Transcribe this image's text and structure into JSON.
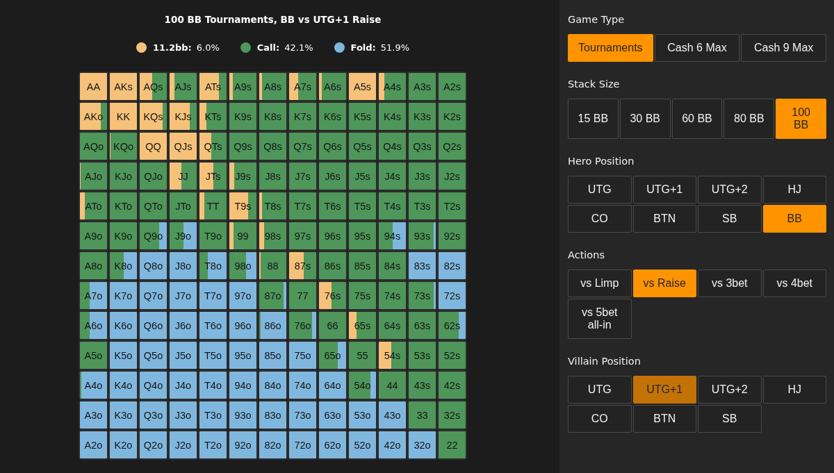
{
  "chart": {
    "title": "100 BB Tournaments, BB vs UTG+1 Raise",
    "legend": [
      {
        "kind": "raise",
        "label": "11.2bb:",
        "value": "6.0%",
        "color": "#f6c27a"
      },
      {
        "kind": "call",
        "label": "Call:",
        "value": "42.1%",
        "color": "#4e965a"
      },
      {
        "kind": "fold",
        "label": "Fold:",
        "value": "51.9%",
        "color": "#80b7df"
      }
    ],
    "rows": [
      {
        "cells": [
          {
            "hand": "AA",
            "segments": [
              {
                "kind": "raise",
                "level": 1
              }
            ]
          },
          {
            "hand": "AKs",
            "segments": [
              {
                "kind": "raise",
                "level": 1
              }
            ]
          },
          {
            "hand": "AQs",
            "segments": [
              {
                "kind": "raise",
                "level": 0.45
              },
              {
                "kind": "call",
                "level": 0.55
              }
            ]
          },
          {
            "hand": "AJs",
            "segments": [
              {
                "kind": "raise",
                "level": 0.17
              },
              {
                "kind": "call",
                "level": 0.83
              }
            ]
          },
          {
            "hand": "ATs",
            "segments": [
              {
                "kind": "raise",
                "level": 0.72
              },
              {
                "kind": "call",
                "level": 0.28
              }
            ]
          },
          {
            "hand": "A9s",
            "segments": [
              {
                "kind": "raise",
                "level": 0.12
              },
              {
                "kind": "call",
                "level": 0.88
              }
            ]
          },
          {
            "hand": "A8s",
            "segments": [
              {
                "kind": "raise",
                "level": 0.1
              },
              {
                "kind": "call",
                "level": 0.9
              }
            ]
          },
          {
            "hand": "A7s",
            "segments": [
              {
                "kind": "raise",
                "level": 0.34
              },
              {
                "kind": "call",
                "level": 0.66
              }
            ]
          },
          {
            "hand": "A6s",
            "segments": [
              {
                "kind": "raise",
                "level": 0.1
              },
              {
                "kind": "call",
                "level": 0.9
              }
            ]
          },
          {
            "hand": "A5s",
            "segments": [
              {
                "kind": "raise",
                "level": 1
              }
            ]
          },
          {
            "hand": "A4s",
            "segments": [
              {
                "kind": "raise",
                "level": 0.2
              },
              {
                "kind": "call",
                "level": 0.8
              }
            ]
          },
          {
            "hand": "A3s",
            "segments": [
              {
                "kind": "call",
                "level": 1
              }
            ]
          },
          {
            "hand": "A2s",
            "segments": [
              {
                "kind": "call",
                "level": 1
              }
            ]
          }
        ]
      },
      {
        "cells": [
          {
            "hand": "AKo",
            "segments": [
              {
                "kind": "raise",
                "level": 0.76
              },
              {
                "kind": "call",
                "level": 0.24
              }
            ]
          },
          {
            "hand": "KK",
            "segments": [
              {
                "kind": "raise",
                "level": 1
              }
            ]
          },
          {
            "hand": "KQs",
            "segments": [
              {
                "kind": "raise",
                "level": 0.85
              },
              {
                "kind": "call",
                "level": 0.15
              }
            ]
          },
          {
            "hand": "KJs",
            "segments": [
              {
                "kind": "raise",
                "level": 0.74
              },
              {
                "kind": "call",
                "level": 0.26
              }
            ]
          },
          {
            "hand": "KTs",
            "segments": [
              {
                "kind": "raise",
                "level": 0.25
              },
              {
                "kind": "call",
                "level": 0.75
              }
            ]
          },
          {
            "hand": "K9s",
            "segments": [
              {
                "kind": "call",
                "level": 1
              }
            ]
          },
          {
            "hand": "K8s",
            "segments": [
              {
                "kind": "call",
                "level": 1
              }
            ]
          },
          {
            "hand": "K7s",
            "segments": [
              {
                "kind": "call",
                "level": 1
              }
            ]
          },
          {
            "hand": "K6s",
            "segments": [
              {
                "kind": "call",
                "level": 1
              }
            ]
          },
          {
            "hand": "K5s",
            "segments": [
              {
                "kind": "call",
                "level": 1
              }
            ]
          },
          {
            "hand": "K4s",
            "segments": [
              {
                "kind": "call",
                "level": 1
              }
            ]
          },
          {
            "hand": "K3s",
            "segments": [
              {
                "kind": "call",
                "level": 1
              }
            ]
          },
          {
            "hand": "K2s",
            "segments": [
              {
                "kind": "call",
                "level": 1
              }
            ]
          }
        ]
      },
      {
        "cells": [
          {
            "hand": "AQo",
            "segments": [
              {
                "kind": "call",
                "level": 1
              }
            ]
          },
          {
            "hand": "KQo",
            "segments": [
              {
                "kind": "raise",
                "level": 0.03
              },
              {
                "kind": "call",
                "level": 0.97
              }
            ]
          },
          {
            "hand": "QQ",
            "segments": [
              {
                "kind": "raise",
                "level": 1
              }
            ]
          },
          {
            "hand": "QJs",
            "segments": [
              {
                "kind": "raise",
                "level": 1
              }
            ]
          },
          {
            "hand": "QTs",
            "segments": [
              {
                "kind": "raise",
                "level": 0.43
              },
              {
                "kind": "call",
                "level": 0.57
              }
            ]
          },
          {
            "hand": "Q9s",
            "segments": [
              {
                "kind": "call",
                "level": 1
              }
            ]
          },
          {
            "hand": "Q8s",
            "segments": [
              {
                "kind": "call",
                "level": 1
              }
            ]
          },
          {
            "hand": "Q7s",
            "segments": [
              {
                "kind": "call",
                "level": 1
              }
            ]
          },
          {
            "hand": "Q6s",
            "segments": [
              {
                "kind": "call",
                "level": 1
              }
            ]
          },
          {
            "hand": "Q5s",
            "segments": [
              {
                "kind": "call",
                "level": 1
              }
            ]
          },
          {
            "hand": "Q4s",
            "segments": [
              {
                "kind": "call",
                "level": 1
              }
            ]
          },
          {
            "hand": "Q3s",
            "segments": [
              {
                "kind": "call",
                "level": 1
              }
            ]
          },
          {
            "hand": "Q2s",
            "segments": [
              {
                "kind": "call",
                "level": 1
              }
            ]
          }
        ]
      },
      {
        "cells": [
          {
            "hand": "AJo",
            "segments": [
              {
                "kind": "raise",
                "level": 0.03
              },
              {
                "kind": "call",
                "level": 0.97
              }
            ]
          },
          {
            "hand": "KJo",
            "segments": [
              {
                "kind": "call",
                "level": 1
              }
            ]
          },
          {
            "hand": "QJo",
            "segments": [
              {
                "kind": "call",
                "level": 1
              }
            ]
          },
          {
            "hand": "JJ",
            "segments": [
              {
                "kind": "raise",
                "level": 0.43
              },
              {
                "kind": "call",
                "level": 0.57
              }
            ]
          },
          {
            "hand": "JTs",
            "segments": [
              {
                "kind": "raise",
                "level": 0.52
              },
              {
                "kind": "call",
                "level": 0.48
              }
            ]
          },
          {
            "hand": "J9s",
            "segments": [
              {
                "kind": "raise",
                "level": 0.18
              },
              {
                "kind": "call",
                "level": 0.82
              }
            ]
          },
          {
            "hand": "J8s",
            "segments": [
              {
                "kind": "call",
                "level": 1
              }
            ]
          },
          {
            "hand": "J7s",
            "segments": [
              {
                "kind": "call",
                "level": 1
              }
            ]
          },
          {
            "hand": "J6s",
            "segments": [
              {
                "kind": "call",
                "level": 1
              }
            ]
          },
          {
            "hand": "J5s",
            "segments": [
              {
                "kind": "call",
                "level": 1
              }
            ]
          },
          {
            "hand": "J4s",
            "segments": [
              {
                "kind": "call",
                "level": 1
              }
            ]
          },
          {
            "hand": "J3s",
            "segments": [
              {
                "kind": "call",
                "level": 1
              }
            ]
          },
          {
            "hand": "J2s",
            "segments": [
              {
                "kind": "call",
                "level": 1
              }
            ]
          }
        ]
      },
      {
        "cells": [
          {
            "hand": "ATo",
            "segments": [
              {
                "kind": "raise",
                "level": 0.17
              },
              {
                "kind": "call",
                "level": 0.83
              }
            ]
          },
          {
            "hand": "KTo",
            "segments": [
              {
                "kind": "call",
                "level": 1
              }
            ]
          },
          {
            "hand": "QTo",
            "segments": [
              {
                "kind": "call",
                "level": 1
              }
            ]
          },
          {
            "hand": "JTo",
            "segments": [
              {
                "kind": "call",
                "level": 1
              }
            ]
          },
          {
            "hand": "TT",
            "segments": [
              {
                "kind": "raise",
                "level": 0.19
              },
              {
                "kind": "call",
                "level": 0.81
              }
            ]
          },
          {
            "hand": "T9s",
            "segments": [
              {
                "kind": "raise",
                "level": 0.68
              },
              {
                "kind": "call",
                "level": 0.32
              }
            ]
          },
          {
            "hand": "T8s",
            "segments": [
              {
                "kind": "raise",
                "level": 0.1
              },
              {
                "kind": "call",
                "level": 0.9
              }
            ]
          },
          {
            "hand": "T7s",
            "segments": [
              {
                "kind": "call",
                "level": 1
              }
            ]
          },
          {
            "hand": "T6s",
            "segments": [
              {
                "kind": "call",
                "level": 1
              }
            ]
          },
          {
            "hand": "T5s",
            "segments": [
              {
                "kind": "call",
                "level": 1
              }
            ]
          },
          {
            "hand": "T4s",
            "segments": [
              {
                "kind": "call",
                "level": 1
              }
            ]
          },
          {
            "hand": "T3s",
            "segments": [
              {
                "kind": "call",
                "level": 1
              }
            ]
          },
          {
            "hand": "T2s",
            "segments": [
              {
                "kind": "call",
                "level": 1
              }
            ]
          }
        ]
      },
      {
        "cells": [
          {
            "hand": "A9o",
            "segments": [
              {
                "kind": "call",
                "level": 1
              }
            ]
          },
          {
            "hand": "K9o",
            "segments": [
              {
                "kind": "call",
                "level": 1
              }
            ]
          },
          {
            "hand": "Q9o",
            "segments": [
              {
                "kind": "call",
                "level": 0.72
              },
              {
                "kind": "fold",
                "level": 0.28
              }
            ]
          },
          {
            "hand": "J9o",
            "segments": [
              {
                "kind": "call",
                "level": 0.52
              },
              {
                "kind": "fold",
                "level": 0.48
              }
            ]
          },
          {
            "hand": "T9o",
            "segments": [
              {
                "kind": "call",
                "level": 1
              }
            ]
          },
          {
            "hand": "99",
            "segments": [
              {
                "kind": "raise",
                "level": 0.15
              },
              {
                "kind": "call",
                "level": 0.85
              }
            ]
          },
          {
            "hand": "98s",
            "segments": [
              {
                "kind": "raise",
                "level": 0.17
              },
              {
                "kind": "call",
                "level": 0.83
              }
            ]
          },
          {
            "hand": "97s",
            "segments": [
              {
                "kind": "call",
                "level": 1
              }
            ]
          },
          {
            "hand": "96s",
            "segments": [
              {
                "kind": "call",
                "level": 1
              }
            ]
          },
          {
            "hand": "95s",
            "segments": [
              {
                "kind": "call",
                "level": 1
              }
            ]
          },
          {
            "hand": "94s",
            "segments": [
              {
                "kind": "call",
                "level": 0.5
              },
              {
                "kind": "fold",
                "level": 0.5
              }
            ]
          },
          {
            "hand": "93s",
            "segments": [
              {
                "kind": "call",
                "level": 0.92
              },
              {
                "kind": "fold",
                "level": 0.08
              }
            ]
          },
          {
            "hand": "92s",
            "segments": [
              {
                "kind": "call",
                "level": 1
              }
            ]
          }
        ]
      },
      {
        "cells": [
          {
            "hand": "A8o",
            "segments": [
              {
                "kind": "call",
                "level": 1
              }
            ]
          },
          {
            "hand": "K8o",
            "segments": [
              {
                "kind": "call",
                "level": 0.5
              },
              {
                "kind": "fold",
                "level": 0.5
              }
            ]
          },
          {
            "hand": "Q8o",
            "segments": [
              {
                "kind": "fold",
                "level": 1
              }
            ]
          },
          {
            "hand": "J8o",
            "segments": [
              {
                "kind": "fold",
                "level": 1
              }
            ]
          },
          {
            "hand": "T8o",
            "segments": [
              {
                "kind": "call",
                "level": 0.3
              },
              {
                "kind": "fold",
                "level": 0.7
              }
            ]
          },
          {
            "hand": "98o",
            "segments": [
              {
                "kind": "call",
                "level": 0.62
              },
              {
                "kind": "fold",
                "level": 0.38
              }
            ]
          },
          {
            "hand": "88",
            "segments": [
              {
                "kind": "raise",
                "level": 0.04
              },
              {
                "kind": "call",
                "level": 0.96
              }
            ]
          },
          {
            "hand": "87s",
            "segments": [
              {
                "kind": "raise",
                "level": 0.55
              },
              {
                "kind": "call",
                "level": 0.45
              }
            ]
          },
          {
            "hand": "86s",
            "segments": [
              {
                "kind": "call",
                "level": 1
              }
            ]
          },
          {
            "hand": "85s",
            "segments": [
              {
                "kind": "call",
                "level": 1
              }
            ]
          },
          {
            "hand": "84s",
            "segments": [
              {
                "kind": "call",
                "level": 1
              }
            ]
          },
          {
            "hand": "83s",
            "segments": [
              {
                "kind": "fold",
                "level": 1
              }
            ]
          },
          {
            "hand": "82s",
            "segments": [
              {
                "kind": "fold",
                "level": 1
              }
            ]
          }
        ]
      },
      {
        "cells": [
          {
            "hand": "A7o",
            "segments": [
              {
                "kind": "call",
                "level": 0.35
              },
              {
                "kind": "fold",
                "level": 0.65
              }
            ]
          },
          {
            "hand": "K7o",
            "segments": [
              {
                "kind": "fold",
                "level": 1
              }
            ]
          },
          {
            "hand": "Q7o",
            "segments": [
              {
                "kind": "fold",
                "level": 1
              }
            ]
          },
          {
            "hand": "J7o",
            "segments": [
              {
                "kind": "fold",
                "level": 1
              }
            ]
          },
          {
            "hand": "T7o",
            "segments": [
              {
                "kind": "fold",
                "level": 1
              }
            ]
          },
          {
            "hand": "97o",
            "segments": [
              {
                "kind": "fold",
                "level": 1
              }
            ]
          },
          {
            "hand": "87o",
            "segments": [
              {
                "kind": "call",
                "level": 0.9
              },
              {
                "kind": "fold",
                "level": 0.1
              }
            ]
          },
          {
            "hand": "77",
            "segments": [
              {
                "kind": "call",
                "level": 1
              }
            ]
          },
          {
            "hand": "76s",
            "segments": [
              {
                "kind": "raise",
                "level": 0.46
              },
              {
                "kind": "call",
                "level": 0.54
              }
            ]
          },
          {
            "hand": "75s",
            "segments": [
              {
                "kind": "call",
                "level": 1
              }
            ]
          },
          {
            "hand": "74s",
            "segments": [
              {
                "kind": "call",
                "level": 1
              }
            ]
          },
          {
            "hand": "73s",
            "segments": [
              {
                "kind": "call",
                "level": 0.92
              },
              {
                "kind": "fold",
                "level": 0.08
              }
            ]
          },
          {
            "hand": "72s",
            "segments": [
              {
                "kind": "fold",
                "level": 1
              }
            ]
          }
        ]
      },
      {
        "cells": [
          {
            "hand": "A6o",
            "segments": [
              {
                "kind": "call",
                "level": 0.35
              },
              {
                "kind": "fold",
                "level": 0.65
              }
            ]
          },
          {
            "hand": "K6o",
            "segments": [
              {
                "kind": "fold",
                "level": 1
              }
            ]
          },
          {
            "hand": "Q6o",
            "segments": [
              {
                "kind": "fold",
                "level": 1
              }
            ]
          },
          {
            "hand": "J6o",
            "segments": [
              {
                "kind": "fold",
                "level": 1
              }
            ]
          },
          {
            "hand": "T6o",
            "segments": [
              {
                "kind": "fold",
                "level": 1
              }
            ]
          },
          {
            "hand": "96o",
            "segments": [
              {
                "kind": "fold",
                "level": 1
              }
            ]
          },
          {
            "hand": "86o",
            "segments": [
              {
                "kind": "call",
                "level": 0.06
              },
              {
                "kind": "fold",
                "level": 0.94
              }
            ]
          },
          {
            "hand": "76o",
            "segments": [
              {
                "kind": "call",
                "level": 0.85
              },
              {
                "kind": "fold",
                "level": 0.15
              }
            ]
          },
          {
            "hand": "66",
            "segments": [
              {
                "kind": "call",
                "level": 1
              }
            ]
          },
          {
            "hand": "65s",
            "segments": [
              {
                "kind": "raise",
                "level": 0.28
              },
              {
                "kind": "call",
                "level": 0.72
              }
            ]
          },
          {
            "hand": "64s",
            "segments": [
              {
                "kind": "call",
                "level": 1
              }
            ]
          },
          {
            "hand": "63s",
            "segments": [
              {
                "kind": "call",
                "level": 1
              }
            ]
          },
          {
            "hand": "62s",
            "segments": [
              {
                "kind": "call",
                "level": 0.74
              },
              {
                "kind": "fold",
                "level": 0.26
              }
            ]
          }
        ]
      },
      {
        "cells": [
          {
            "hand": "A5o",
            "segments": [
              {
                "kind": "call",
                "level": 1
              }
            ]
          },
          {
            "hand": "K5o",
            "segments": [
              {
                "kind": "fold",
                "level": 1
              }
            ]
          },
          {
            "hand": "Q5o",
            "segments": [
              {
                "kind": "fold",
                "level": 1
              }
            ]
          },
          {
            "hand": "J5o",
            "segments": [
              {
                "kind": "fold",
                "level": 1
              }
            ]
          },
          {
            "hand": "T5o",
            "segments": [
              {
                "kind": "fold",
                "level": 1
              }
            ]
          },
          {
            "hand": "95o",
            "segments": [
              {
                "kind": "fold",
                "level": 1
              }
            ]
          },
          {
            "hand": "85o",
            "segments": [
              {
                "kind": "fold",
                "level": 1
              }
            ]
          },
          {
            "hand": "75o",
            "segments": [
              {
                "kind": "fold",
                "level": 1
              }
            ]
          },
          {
            "hand": "65o",
            "segments": [
              {
                "kind": "call",
                "level": 0.7
              },
              {
                "kind": "fold",
                "level": 0.3
              }
            ]
          },
          {
            "hand": "55",
            "segments": [
              {
                "kind": "call",
                "level": 1
              }
            ]
          },
          {
            "hand": "54s",
            "segments": [
              {
                "kind": "raise",
                "level": 0.47
              },
              {
                "kind": "call",
                "level": 0.53
              }
            ]
          },
          {
            "hand": "53s",
            "segments": [
              {
                "kind": "call",
                "level": 1
              }
            ]
          },
          {
            "hand": "52s",
            "segments": [
              {
                "kind": "call",
                "level": 1
              }
            ]
          }
        ]
      },
      {
        "cells": [
          {
            "hand": "A4o",
            "segments": [
              {
                "kind": "call",
                "level": 0.05
              },
              {
                "kind": "fold",
                "level": 0.95
              }
            ]
          },
          {
            "hand": "K4o",
            "segments": [
              {
                "kind": "fold",
                "level": 1
              }
            ]
          },
          {
            "hand": "Q4o",
            "segments": [
              {
                "kind": "fold",
                "level": 1
              }
            ]
          },
          {
            "hand": "J4o",
            "segments": [
              {
                "kind": "fold",
                "level": 1
              }
            ]
          },
          {
            "hand": "T4o",
            "segments": [
              {
                "kind": "fold",
                "level": 1
              }
            ]
          },
          {
            "hand": "94o",
            "segments": [
              {
                "kind": "fold",
                "level": 1
              }
            ]
          },
          {
            "hand": "84o",
            "segments": [
              {
                "kind": "fold",
                "level": 1
              }
            ]
          },
          {
            "hand": "74o",
            "segments": [
              {
                "kind": "fold",
                "level": 1
              }
            ]
          },
          {
            "hand": "64o",
            "segments": [
              {
                "kind": "fold",
                "level": 1
              }
            ]
          },
          {
            "hand": "54o",
            "segments": [
              {
                "kind": "call",
                "level": 0.8
              },
              {
                "kind": "fold",
                "level": 0.2
              }
            ]
          },
          {
            "hand": "44",
            "segments": [
              {
                "kind": "call",
                "level": 1
              }
            ]
          },
          {
            "hand": "43s",
            "segments": [
              {
                "kind": "call",
                "level": 1
              }
            ]
          },
          {
            "hand": "42s",
            "segments": [
              {
                "kind": "call",
                "level": 1
              }
            ]
          }
        ]
      },
      {
        "cells": [
          {
            "hand": "A3o",
            "segments": [
              {
                "kind": "fold",
                "level": 1
              }
            ]
          },
          {
            "hand": "K3o",
            "segments": [
              {
                "kind": "fold",
                "level": 1
              }
            ]
          },
          {
            "hand": "Q3o",
            "segments": [
              {
                "kind": "fold",
                "level": 1
              }
            ]
          },
          {
            "hand": "J3o",
            "segments": [
              {
                "kind": "fold",
                "level": 1
              }
            ]
          },
          {
            "hand": "T3o",
            "segments": [
              {
                "kind": "fold",
                "level": 1
              }
            ]
          },
          {
            "hand": "93o",
            "segments": [
              {
                "kind": "fold",
                "level": 1
              }
            ]
          },
          {
            "hand": "83o",
            "segments": [
              {
                "kind": "fold",
                "level": 1
              }
            ]
          },
          {
            "hand": "73o",
            "segments": [
              {
                "kind": "fold",
                "level": 1
              }
            ]
          },
          {
            "hand": "63o",
            "segments": [
              {
                "kind": "fold",
                "level": 1
              }
            ]
          },
          {
            "hand": "53o",
            "segments": [
              {
                "kind": "fold",
                "level": 1
              }
            ]
          },
          {
            "hand": "43o",
            "segments": [
              {
                "kind": "fold",
                "level": 1
              }
            ]
          },
          {
            "hand": "33",
            "segments": [
              {
                "kind": "call",
                "level": 1
              }
            ]
          },
          {
            "hand": "32s",
            "segments": [
              {
                "kind": "call",
                "level": 1
              }
            ]
          }
        ]
      },
      {
        "cells": [
          {
            "hand": "A2o",
            "segments": [
              {
                "kind": "fold",
                "level": 1
              }
            ]
          },
          {
            "hand": "K2o",
            "segments": [
              {
                "kind": "fold",
                "level": 1
              }
            ]
          },
          {
            "hand": "Q2o",
            "segments": [
              {
                "kind": "fold",
                "level": 1
              }
            ]
          },
          {
            "hand": "J2o",
            "segments": [
              {
                "kind": "fold",
                "level": 1
              }
            ]
          },
          {
            "hand": "T2o",
            "segments": [
              {
                "kind": "fold",
                "level": 1
              }
            ]
          },
          {
            "hand": "92o",
            "segments": [
              {
                "kind": "fold",
                "level": 1
              }
            ]
          },
          {
            "hand": "82o",
            "segments": [
              {
                "kind": "fold",
                "level": 1
              }
            ]
          },
          {
            "hand": "72o",
            "segments": [
              {
                "kind": "fold",
                "level": 1
              }
            ]
          },
          {
            "hand": "62o",
            "segments": [
              {
                "kind": "fold",
                "level": 1
              }
            ]
          },
          {
            "hand": "52o",
            "segments": [
              {
                "kind": "fold",
                "level": 1
              }
            ]
          },
          {
            "hand": "42o",
            "segments": [
              {
                "kind": "fold",
                "level": 1
              }
            ]
          },
          {
            "hand": "32o",
            "segments": [
              {
                "kind": "fold",
                "level": 1
              }
            ]
          },
          {
            "hand": "22",
            "segments": [
              {
                "kind": "call",
                "level": 1
              }
            ]
          }
        ]
      }
    ]
  },
  "panel": {
    "sections": [
      {
        "title": "Game Type",
        "options": [
          {
            "label": "Tournaments",
            "selected": true
          },
          {
            "label": "Cash 6 Max",
            "selected": false
          },
          {
            "label": "Cash 9 Max",
            "selected": false
          }
        ]
      },
      {
        "title": "Stack Size",
        "options": [
          {
            "label": "15 BB",
            "selected": false
          },
          {
            "label": "30 BB",
            "selected": false
          },
          {
            "label": "60 BB",
            "selected": false
          },
          {
            "label": "80 BB",
            "selected": false
          },
          {
            "label": "100 BB",
            "selected": true
          }
        ]
      },
      {
        "title": "Hero Position",
        "options": [
          {
            "label": "UTG",
            "selected": false
          },
          {
            "label": "UTG+1",
            "selected": false
          },
          {
            "label": "UTG+2",
            "selected": false
          },
          {
            "label": "HJ",
            "selected": false
          },
          {
            "label": "CO",
            "selected": false
          },
          {
            "label": "BTN",
            "selected": false
          },
          {
            "label": "SB",
            "selected": false
          },
          {
            "label": "BB",
            "selected": true
          }
        ]
      },
      {
        "title": "Actions",
        "options": [
          {
            "label": "vs Limp",
            "selected": false
          },
          {
            "label": "vs Raise",
            "selected": true
          },
          {
            "label": "vs 3bet",
            "selected": false
          },
          {
            "label": "vs 4bet",
            "selected": false
          },
          {
            "label": "vs 5bet all-in",
            "selected": false
          }
        ]
      },
      {
        "title": "Villain Position",
        "options": [
          {
            "label": "UTG",
            "selected": false,
            "hovered": false
          },
          {
            "label": "UTG+1",
            "selected": true,
            "hovered": true
          },
          {
            "label": "UTG+2",
            "selected": false,
            "hovered": false
          },
          {
            "label": "HJ",
            "selected": false,
            "hovered": false
          },
          {
            "label": "CO",
            "selected": false,
            "hovered": false
          },
          {
            "label": "BTN",
            "selected": false,
            "hovered": false
          },
          {
            "label": "SB",
            "selected": false,
            "hovered": false
          }
        ]
      }
    ]
  }
}
